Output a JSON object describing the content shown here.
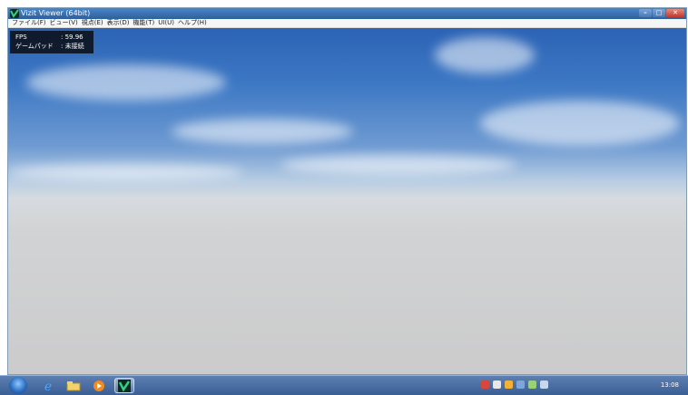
{
  "window": {
    "title": "Vizit Viewer (64bit)",
    "controls": {
      "minimize": "–",
      "maximize": "□",
      "close": "✕"
    }
  },
  "menu": [
    {
      "label": "ファイル(F)"
    },
    {
      "label": "ビュー(V)"
    },
    {
      "label": "視点(E)"
    },
    {
      "label": "表示(D)"
    },
    {
      "label": "機能(T)"
    },
    {
      "label": "UI(U)"
    },
    {
      "label": "ヘルプ(H)"
    }
  ],
  "overlay": {
    "fps_label": "FPS",
    "fps_value": ": 59.96",
    "gamepad_label": "ゲームパッド",
    "gamepad_value": ": 未接続"
  },
  "taskbar": {
    "items": [
      "windows-start-icon",
      "internet-explorer-icon",
      "file-explorer-icon",
      "media-player-icon",
      "vizit-viewer-icon"
    ],
    "tray_icons": [
      "antivirus-icon",
      "ime-icon",
      "language-bar-icon",
      "network-icon",
      "volume-icon",
      "show-hidden-icons-icon"
    ],
    "clock": "13:08"
  },
  "colors": {
    "sky_top": "#2c63b5",
    "horizon": "#d6dbe0",
    "ground": "#cbcbcc",
    "taskbar": "#3a5f95",
    "overlay_bg": "#0a0e16"
  }
}
